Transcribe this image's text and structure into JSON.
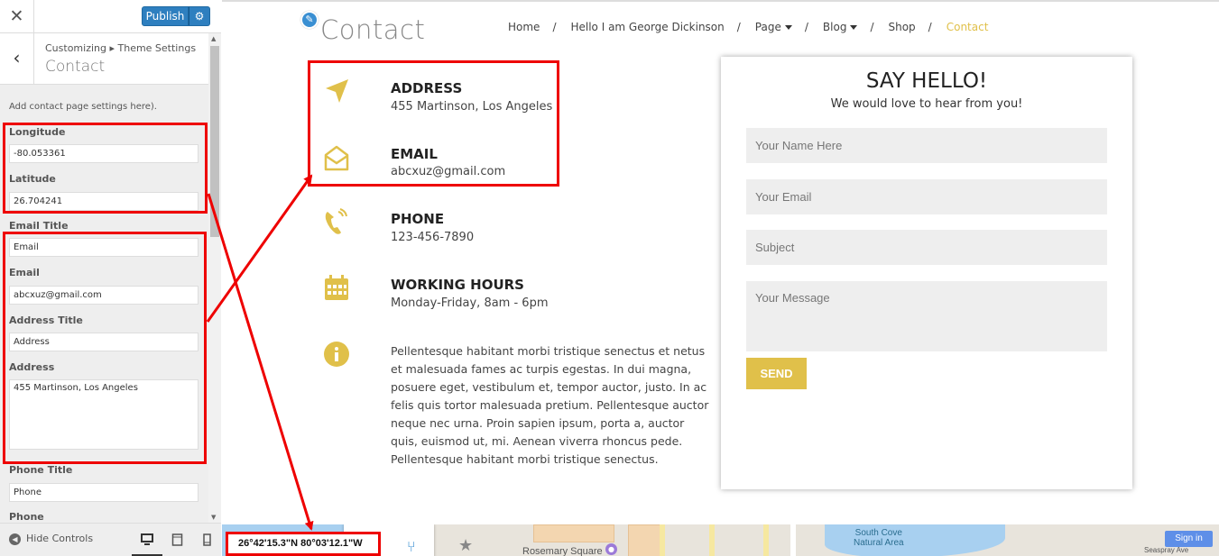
{
  "sidebar": {
    "close_glyph": "✕",
    "publish_label": "Publish",
    "gear_glyph": "⚙",
    "back_glyph": "‹",
    "breadcrumb": "Customizing ▸ Theme Settings",
    "section_title": "Contact",
    "description": "Add contact page settings here).",
    "controls": {
      "longitude_label": "Longitude",
      "longitude_value": "-80.053361",
      "latitude_label": "Latitude",
      "latitude_value": "26.704241",
      "email_title_label": "Email Title",
      "email_title_value": "Email",
      "email_label": "Email",
      "email_value": "abcxuz@gmail.com",
      "address_title_label": "Address Title",
      "address_title_value": "Address",
      "address_label": "Address",
      "address_value": "455 Martinson, Los Angeles",
      "phone_title_label": "Phone Title",
      "phone_title_value": "Phone",
      "phone_label": "Phone"
    },
    "footer": {
      "hide_controls_label": "Hide Controls",
      "devices": [
        "desktop-icon",
        "tablet-icon",
        "mobile-icon"
      ],
      "active_device": "desktop"
    },
    "scroll_up": "▲",
    "scroll_down": "▼"
  },
  "preview": {
    "page_title": "Contact",
    "edit_glyph": "✎",
    "nav": {
      "items": [
        "Home",
        "Hello I am George Dickinson",
        "Page",
        "Blog",
        "Shop",
        "Contact"
      ],
      "separator": "/",
      "active": "Contact"
    },
    "info": [
      {
        "icon": "location-arrow-icon",
        "title": "ADDRESS",
        "value": "455 Martinson, Los Angeles"
      },
      {
        "icon": "envelope-open-icon",
        "title": "EMAIL",
        "value": "abcxuz@gmail.com"
      },
      {
        "icon": "phone-icon",
        "title": "PHONE",
        "value": "123-456-7890"
      },
      {
        "icon": "calendar-icon",
        "title": "WORKING HOURS",
        "value": "Monday-Friday, 8am - 6pm"
      },
      {
        "icon": "info-circle-icon",
        "title": "",
        "value": ""
      }
    ],
    "lorem": "Pellentesque habitant morbi tristique senectus et netus et malesuada fames ac turpis egestas. In dui magna, posuere eget, vestibulum et, tempor auctor, justo. In ac felis quis tortor malesuada pretium. Pellentesque auctor neque nec urna. Proin sapien ipsum, porta a, auctor quis, euismod ut, mi. Aenean viverra rhoncus pede. Pellentesque habitant morbi tristique senectus.",
    "form": {
      "heading": "SAY HELLO!",
      "subheading": "We would love to hear from you!",
      "name_placeholder": "Your Name Here",
      "email_placeholder": "Your Email",
      "subject_placeholder": "Subject",
      "message_placeholder": "Your Message",
      "send_label": "SEND"
    },
    "map": {
      "coordinates": "26°42'15.3\"N 80°03'12.1\"W",
      "route_glyph": "⑂",
      "star_glyph": "★",
      "labels": {
        "rosemary": "Rosemary Square",
        "south_cove_line1": "South Cove",
        "south_cove_line2": "Natural Area",
        "seaspray": "Seaspray Ave"
      },
      "signin_label": "Sign in"
    }
  },
  "colors": {
    "accent_gold": "#e0c04a",
    "publish_blue": "#2e7fbf",
    "annotation_red": "#ee0000"
  }
}
